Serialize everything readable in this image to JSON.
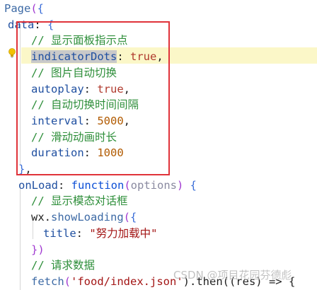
{
  "code": {
    "l1_page": "Page",
    "l1_paren": "(",
    "l1_brace": "{",
    "l2_data": "data",
    "l2_colon": ": ",
    "l2_brace": "{",
    "l3_comment": "// 显示面板指示点",
    "l4_prop": "indicatorDots",
    "l4_colon": ": ",
    "l4_val": "true",
    "l4_comma": ",",
    "l5_comment": "// 图片自动切换",
    "l6_prop": "autoplay",
    "l6_colon": ": ",
    "l6_val": "true",
    "l6_comma": ",",
    "l7_comment": "// 自动切换时间间隔",
    "l8_prop": "interval",
    "l8_colon": ": ",
    "l8_val": "5000",
    "l8_comma": ",",
    "l9_comment": "// 滑动动画时长",
    "l10_prop": "duration",
    "l10_colon": ": ",
    "l10_val": "1000",
    "l11_close": "}",
    "l11_comma": ",",
    "l12_prop": "onLoad",
    "l12_colon": ": ",
    "l12_kw": "function",
    "l12_paren_open": "(",
    "l12_param": "options",
    "l12_paren_close": ")",
    "l12_brace": " {",
    "l13_comment": "// 显示模态对话框",
    "l14_obj": "wx",
    "l14_dot": ".",
    "l14_method": "showLoading",
    "l14_paren": "(",
    "l14_brace": "{",
    "l15_prop": "title",
    "l15_colon": ": ",
    "l15_str": "\"努力加载中\"",
    "l16_close": "})",
    "l17_comment": "// 请求数据",
    "l18_fn": "fetch",
    "l18_paren": "(",
    "l18_str": "'food/index.json'",
    "l18_rest": ").then((res) => {"
  },
  "watermark": "CSDN @项目花园芬德彪",
  "colors": {
    "redbox": "#e0333a",
    "line_highlight": "#fbf7c8",
    "comment": "#2f8f3b",
    "number": "#b15a00"
  },
  "icons": {
    "gutter": "lightbulb-icon"
  }
}
